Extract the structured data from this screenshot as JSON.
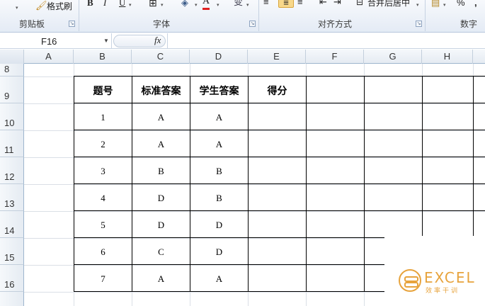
{
  "ribbon": {
    "clipboard": {
      "format_painter": "格式刷",
      "group_label": "剪贴板"
    },
    "font": {
      "bold": "B",
      "italic": "I",
      "underline": "U",
      "font_color_glyph": "A",
      "group_label": "字体",
      "phonetic_glyph": "变"
    },
    "alignment": {
      "merge_center": "合并后居中",
      "group_label": "对齐方式"
    },
    "number": {
      "percent": "%",
      "group_label": "数字"
    }
  },
  "formula_bar": {
    "name_box": "F16",
    "fx_label": "fx",
    "formula": ""
  },
  "columns": [
    "A",
    "B",
    "C",
    "D",
    "E",
    "F",
    "G",
    "H"
  ],
  "rows": [
    "8",
    "9",
    "10",
    "11",
    "12",
    "13",
    "14",
    "15",
    "16"
  ],
  "table": {
    "headers": [
      "题号",
      "标准答案",
      "学生答案",
      "得分"
    ],
    "rows": [
      [
        "1",
        "A",
        "A",
        ""
      ],
      [
        "2",
        "A",
        "A",
        ""
      ],
      [
        "3",
        "B",
        "B",
        ""
      ],
      [
        "4",
        "D",
        "B",
        ""
      ],
      [
        "5",
        "D",
        "D",
        ""
      ],
      [
        "6",
        "C",
        "D",
        ""
      ],
      [
        "7",
        "A",
        "A",
        ""
      ]
    ]
  },
  "watermark": {
    "brand": "EXCEL",
    "tagline": "效率干训",
    "accent_color": "#e7a33c"
  }
}
